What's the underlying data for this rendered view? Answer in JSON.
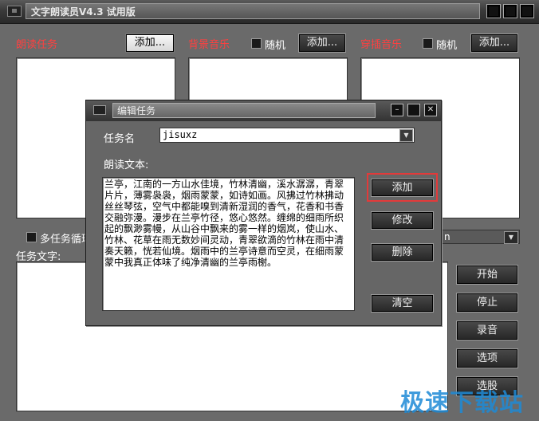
{
  "app": {
    "title": "文字朗读员V4.3 试用版"
  },
  "sections": {
    "read_task": {
      "label": "朗读任务",
      "add_label": "添加..."
    },
    "bg_music": {
      "label": "背景音乐",
      "random_label": "随机",
      "add_label": "添加..."
    },
    "insert_music": {
      "label": "穿插音乐",
      "random_label": "随机",
      "add_label": "添加..."
    }
  },
  "multi_loop_label": "多任务循环",
  "task_text_label": "任务文字:",
  "dropdown_partial": "n",
  "side_buttons": [
    "开始",
    "停止",
    "录音",
    "选项",
    "选股"
  ],
  "dialog": {
    "title": "编辑任务",
    "task_name_label": "任务名",
    "task_name_value": "jisuxz",
    "read_text_label": "朗读文本:",
    "read_text": "兰亭，江南的一方山水佳境，竹林清幽，溪水潺潺，青翠片片，薄雾袅袅，烟雨蒙蒙，如诗如画。风拂过竹林拂动丝丝琴弦，空气中都能嗅到清新湿润的香气，花香和书香交融弥漫。漫步在兰亭竹径，悠心悠然。缠绵的细雨所织起的飘渺雾幔，从山谷中飘来的雾一样的烟岚，使山水、竹林、花草在雨无数妙间灵动，青翠欲滴的竹林在雨中清奏天籁，恍若仙境。烟雨中的兰亭诗意而空灵，在细雨蒙蒙中我真正体味了纯净清幽的兰亭雨榭。",
    "buttons": {
      "add": "添加",
      "modify": "修改",
      "delete": "删除",
      "clear": "清空"
    }
  },
  "watermark": "极速下载站"
}
